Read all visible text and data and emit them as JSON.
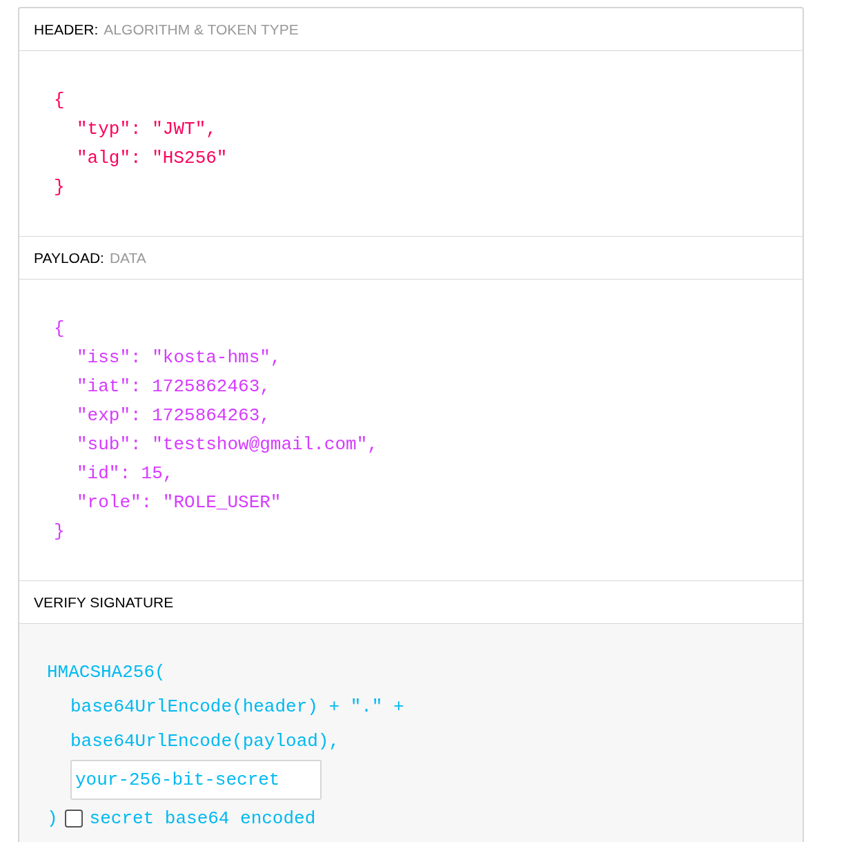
{
  "sections": [
    {
      "kind": "code",
      "title": "HEADER:",
      "subtitle": "ALGORITHM & TOKEN TYPE",
      "color": "#fb015b",
      "open": "{",
      "entries": [
        "\"typ\": \"JWT\",",
        "\"alg\": \"HS256\""
      ],
      "close": "}"
    },
    {
      "kind": "code",
      "title": "PAYLOAD:",
      "subtitle": "DATA",
      "color": "#d63aff",
      "open": "{",
      "entries": [
        "\"iss\": \"kosta-hms\",",
        "\"iat\": 1725862463,",
        "\"exp\": 1725864263,",
        "\"sub\": \"testshow@gmail.com\",",
        "\"id\": 15,",
        "\"role\": \"ROLE_USER\""
      ],
      "close": "}"
    },
    {
      "kind": "signature",
      "title": "VERIFY SIGNATURE",
      "color": "#00b9f1",
      "open": "HMACSHA256(",
      "entries": [
        "base64UrlEncode(header) + \".\" +",
        "base64UrlEncode(payload),"
      ],
      "secret": {
        "value": "your-256-bit-secret"
      },
      "close": ")",
      "base64": {
        "label": "secret base64 encoded",
        "checked": false
      }
    }
  ]
}
